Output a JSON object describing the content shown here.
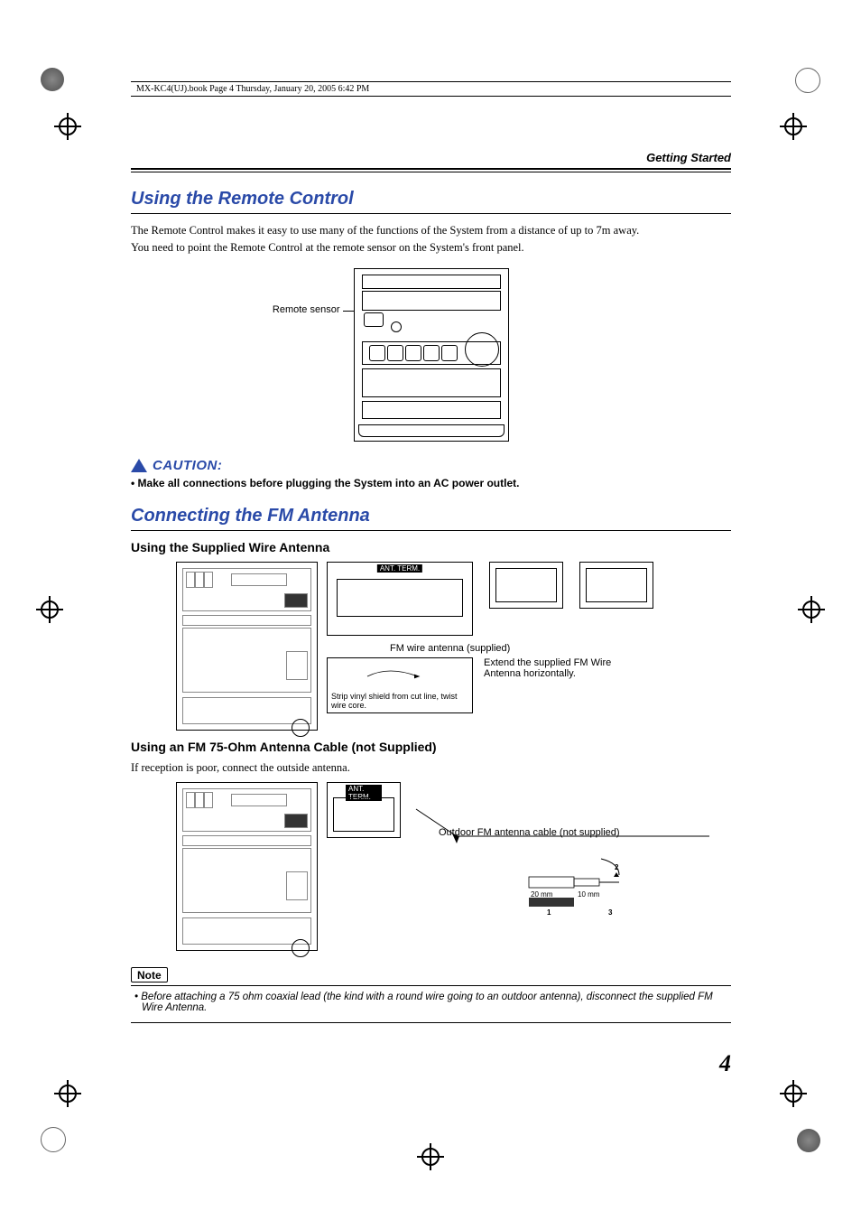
{
  "meta": {
    "bookline": "MX-KC4(UJ).book  Page 4  Thursday, January 20, 2005  6:42 PM"
  },
  "header": {
    "running": "Getting Started"
  },
  "section1": {
    "title": "Using the Remote Control",
    "p1": "The Remote Control makes it easy to use many of the functions of the System from a distance of up to 7m away.",
    "p2": "You need to point the Remote Control at the remote sensor on the System's front panel.",
    "fig_label": "Remote sensor"
  },
  "caution": {
    "label": "CAUTION:",
    "bullet": "•  Make all connections before plugging the System into an AC power outlet."
  },
  "section2": {
    "title": "Connecting the FM Antenna",
    "sub1": "Using the Supplied Wire Antenna",
    "fig1": {
      "terminal_label": "ANT. TERM.",
      "wire_label": "FM wire antenna (supplied)",
      "extend_label": "Extend the supplied FM Wire Antenna horizontally.",
      "strip_label": "Strip vinyl shield from cut line, twist wire core."
    },
    "sub2": "Using an FM 75-Ohm Antenna Cable (not Supplied)",
    "p_sub2": "If reception is poor, connect the outside antenna.",
    "fig2": {
      "terminal_label": "ANT. TERM.",
      "outdoor_label": "Outdoor FM antenna cable (not supplied)",
      "dim1": "20 mm",
      "dim2": "10 mm",
      "step1": "1",
      "step2": "2",
      "step3": "3"
    }
  },
  "note": {
    "label": "Note",
    "text": "• Before attaching a 75 ohm coaxial lead (the kind with a round wire going to an outdoor antenna), disconnect the supplied FM Wire Antenna."
  },
  "footer": {
    "page": "4"
  }
}
